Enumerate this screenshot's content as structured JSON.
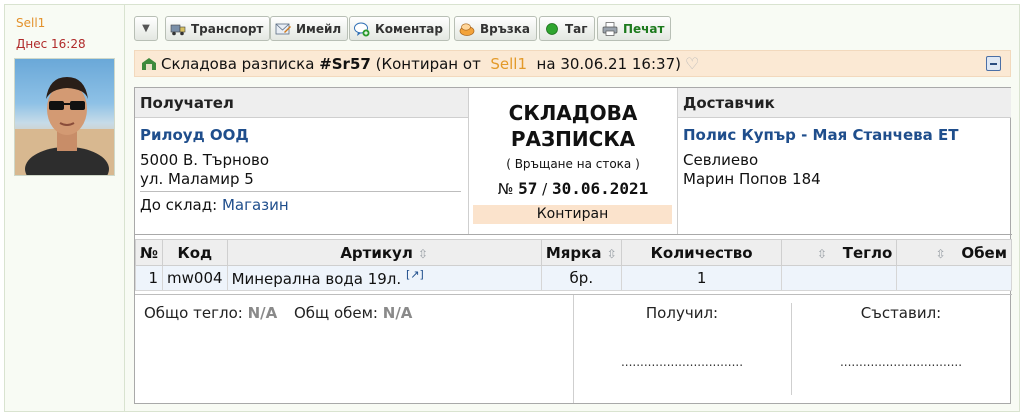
{
  "user": {
    "name": "Sell1",
    "date": "Днес 16:28"
  },
  "toolbar": {
    "buttons": [
      {
        "label": "Транспорт",
        "icon": "truck-icon"
      },
      {
        "label": "Имейл",
        "icon": "email-icon"
      },
      {
        "label": "Коментар",
        "icon": "comment-icon"
      },
      {
        "label": "Връзка",
        "icon": "link-icon"
      },
      {
        "label": "Таг",
        "icon": "tag-icon"
      },
      {
        "label": "Печат",
        "icon": "print-icon"
      }
    ]
  },
  "titlebar": {
    "prefix": "Складова разписка",
    "number": "#Sr57",
    "status_text": "(Контиран от",
    "user": "Sell1",
    "date": "на 30.06.21 16:37)"
  },
  "doc": {
    "recipient_label": "Получател",
    "recipient_name": "Рилоуд ООД",
    "recipient_addr1": "5000 В. Търново",
    "recipient_addr2": "ул. Маламир 5",
    "to_store_label": "До склад:",
    "to_store": "Магазин",
    "title_line1": "СКЛАДОВА",
    "title_line2": "РАЗПИСКА",
    "subtitle": "( Връщане на стока )",
    "number_prefix": "№",
    "number": "57",
    "number_sep": "/",
    "date": "30.06.2021",
    "status": "Контиран",
    "supplier_label": "Доставчик",
    "supplier_name": "Полис Купър - Мая Станчева ЕТ",
    "supplier_addr1": "Севлиево",
    "supplier_addr2": "Марин Попов 184"
  },
  "table": {
    "headers": [
      "№",
      "Код",
      "Артикул",
      "Мярка",
      "Количество",
      "Тегло",
      "Обем"
    ],
    "rows": [
      {
        "no": "1",
        "code": "mw004",
        "article": "Минерална вода 19л.",
        "unit": "бр.",
        "qty": "1",
        "weight": "",
        "volume": ""
      }
    ]
  },
  "footer": {
    "weight_label": "Общо тегло:",
    "weight_value": "N/A",
    "volume_label": "Общ обем:",
    "volume_value": "N/A",
    "received_label": "Получил:",
    "composed_label": "Съставил:",
    "dots": "................................"
  }
}
